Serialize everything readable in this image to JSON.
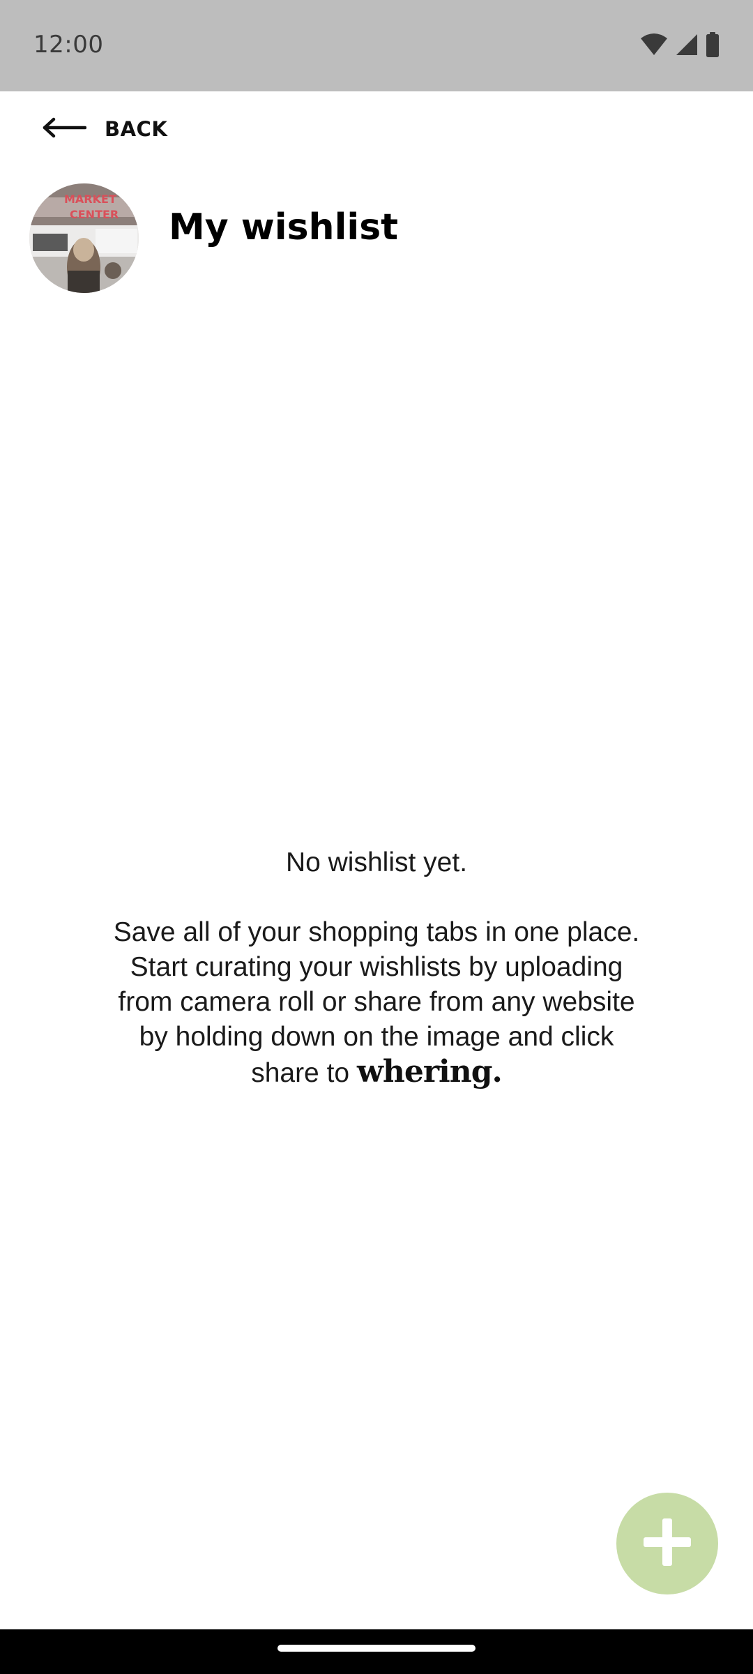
{
  "status_bar": {
    "time": "12:00",
    "icons": [
      "wifi-icon",
      "cellular-signal-icon",
      "battery-icon"
    ]
  },
  "nav": {
    "back_label": "BACK"
  },
  "header": {
    "title": "My wishlist",
    "avatar_alt": "profile photo"
  },
  "empty_state": {
    "title": "No wishlist yet.",
    "lines": [
      "Save all of your shopping tabs in one place.",
      "Start curating your wishlists by uploading",
      "from camera roll or share from any website",
      "by holding down on the image and click"
    ],
    "last_line_prefix": "share to",
    "brand": "whering."
  },
  "fab": {
    "icon": "plus-icon"
  },
  "colors": {
    "status_bar_bg": "#bdbdbd",
    "fab_bg": "#c7dca6",
    "text": "#1a1a1a",
    "nav_bar_bg": "#000000"
  }
}
